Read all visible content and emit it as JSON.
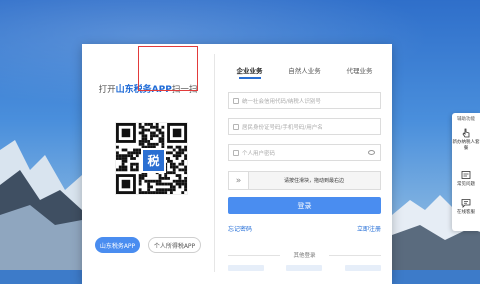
{
  "scan": {
    "prefix": "打开",
    "brand": "山东税务APP",
    "suffix": "扫一扫",
    "logo_char": "税"
  },
  "app_buttons": {
    "primary": "山东税务APP",
    "secondary": "个人所得税APP"
  },
  "tabs": [
    {
      "label": "企业业务",
      "active": true
    },
    {
      "label": "自然人业务",
      "active": false
    },
    {
      "label": "代理业务",
      "active": false
    }
  ],
  "form": {
    "credit_code_placeholder": "统一社会信用代码/纳税人识别号",
    "id_placeholder": "居民身份证号码/手机号码/用户名",
    "password_placeholder": "个人用户密码",
    "slider_text": "请按住滑块，拖动到最右边",
    "login_button": "登录",
    "forgot_password": "忘记密码",
    "register": "立即注册",
    "other_login": "其他登录"
  },
  "side_panel": {
    "title": "辅助功能",
    "items": [
      {
        "label": "新办纳税人套餐",
        "icon": "hand-pointer-icon"
      },
      {
        "label": "常见问题",
        "icon": "faq-icon"
      },
      {
        "label": "在线客服",
        "icon": "chat-icon"
      }
    ]
  },
  "colors": {
    "accent": "#2a6fd2",
    "button": "#4a8df0",
    "highlight": "#e23b3b"
  }
}
